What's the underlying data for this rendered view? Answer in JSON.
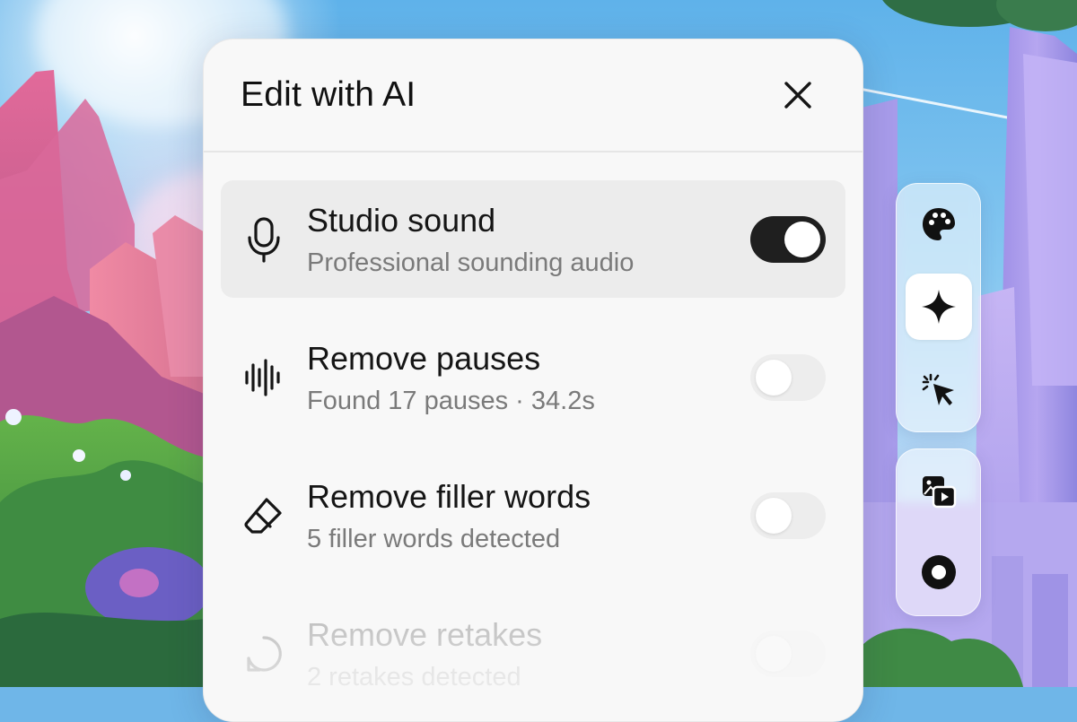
{
  "dialog": {
    "title": "Edit with AI",
    "close_icon": "close-icon",
    "items": [
      {
        "id": "studio-sound",
        "title": "Studio sound",
        "subtitle": "Professional sounding audio",
        "icon": "microphone-icon",
        "enabled": true,
        "highlighted": true
      },
      {
        "id": "remove-pauses",
        "title": "Remove pauses",
        "subtitle": "Found 17 pauses · 34.2s",
        "icon": "waveform-icon",
        "enabled": false
      },
      {
        "id": "remove-filler-words",
        "title": "Remove filler words",
        "subtitle": "5 filler words detected",
        "icon": "eraser-icon",
        "enabled": false
      },
      {
        "id": "remove-retakes",
        "title": "Remove retakes",
        "subtitle": "2 retakes detected",
        "icon": "retake-icon",
        "enabled": false,
        "faded": true
      }
    ]
  },
  "toolbar": {
    "groups": [
      {
        "tools": [
          {
            "name": "palette-icon",
            "selected": false
          },
          {
            "name": "sparkle-icon",
            "selected": true
          },
          {
            "name": "magic-cursor-icon",
            "selected": false
          }
        ]
      },
      {
        "tools": [
          {
            "name": "media-icon",
            "selected": false
          },
          {
            "name": "record-icon",
            "selected": false
          }
        ]
      }
    ]
  },
  "colors": {
    "toggle_on": "#1f1f1f",
    "toggle_off": "#ededed",
    "panel_bg": "#f8f8f8",
    "row_highlight": "#ececec"
  }
}
